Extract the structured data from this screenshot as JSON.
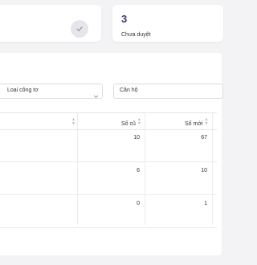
{
  "stats": {
    "pending_count": "3",
    "pending_label": "Chưa duyệt"
  },
  "filters": {
    "meter_type_label": "Loại công tơ",
    "apartment_label": "Căn hộ"
  },
  "table": {
    "columns": {
      "old_reading": "Số cũ",
      "new_reading": "Số mới"
    },
    "rows": [
      {
        "old": "10",
        "new": "67"
      },
      {
        "old": "6",
        "new": "10"
      },
      {
        "old": "0",
        "new": "1"
      }
    ]
  }
}
